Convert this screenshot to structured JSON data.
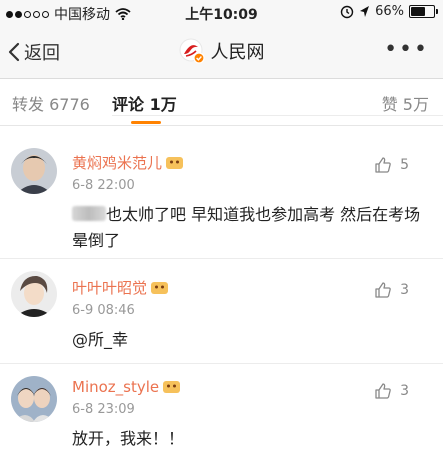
{
  "status_bar": {
    "carrier": "中国移动",
    "time": "上午10:09",
    "battery": "66%",
    "battery_level": 0.66
  },
  "nav": {
    "back_label": "返回",
    "title": "人民网",
    "more_label": "•••"
  },
  "tabs": {
    "repost_label": "转发 6776",
    "comment_label": "评论 1万",
    "like_label": "赞 5万"
  },
  "comments": [
    {
      "username": "黄焖鸡米范儿",
      "time": "6-8 22:00",
      "likes": "5",
      "text": "也太帅了吧 早知道我也参加高考 然后在考场晕倒了"
    },
    {
      "username": "叶叶叶昭觉",
      "time": "6-9 08:46",
      "likes": "3",
      "text": "@所_幸"
    },
    {
      "username": "Minoz_style",
      "time": "6-8 23:09",
      "likes": "3",
      "text": "放开，我来！！"
    }
  ],
  "colors": {
    "accent": "#ff8200",
    "username": "#eb7350",
    "nav_bg": "#f7f7f7"
  },
  "icons": [
    "signal-dots-icon",
    "wifi-icon",
    "location-icon",
    "alarm-icon",
    "battery-icon",
    "back-chevron-icon",
    "people-daily-logo-icon",
    "verified-badge-icon",
    "more-dots-icon",
    "thumb-up-icon",
    "vip-badge-icon"
  ]
}
